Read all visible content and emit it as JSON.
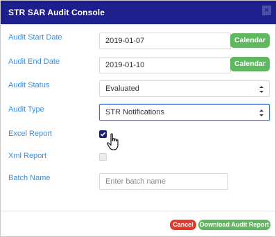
{
  "dialog": {
    "title": "STR SAR Audit Console",
    "close_icon": "close-icon",
    "close_glyph": "×"
  },
  "form": {
    "audit_start_date": {
      "label": "Audit Start Date",
      "value": "2019-01-07",
      "button": "Calendar"
    },
    "audit_end_date": {
      "label": "Audit End Date",
      "value": "2019-01-10",
      "button": "Calendar"
    },
    "audit_status": {
      "label": "Audit Status",
      "selected": "Evaluated"
    },
    "audit_type": {
      "label": "Audit Type",
      "selected": "STR Notifications"
    },
    "excel_report": {
      "label": "Excel Report",
      "checked": true
    },
    "xml_report": {
      "label": "Xml Report",
      "checked": false
    },
    "batch_name": {
      "label": "Batch Name",
      "value": "",
      "placeholder": "Enter batch name"
    }
  },
  "footer": {
    "cancel_label": "Cancel",
    "download_label": "Download Audit Report"
  },
  "colors": {
    "titlebar": "#1c1f8c",
    "label": "#3a8ed8",
    "calendar_button": "#5fb85f",
    "cancel_button": "#e23b2e",
    "download_button": "#5fb85f",
    "checkbox_checked": "#1c2073"
  }
}
